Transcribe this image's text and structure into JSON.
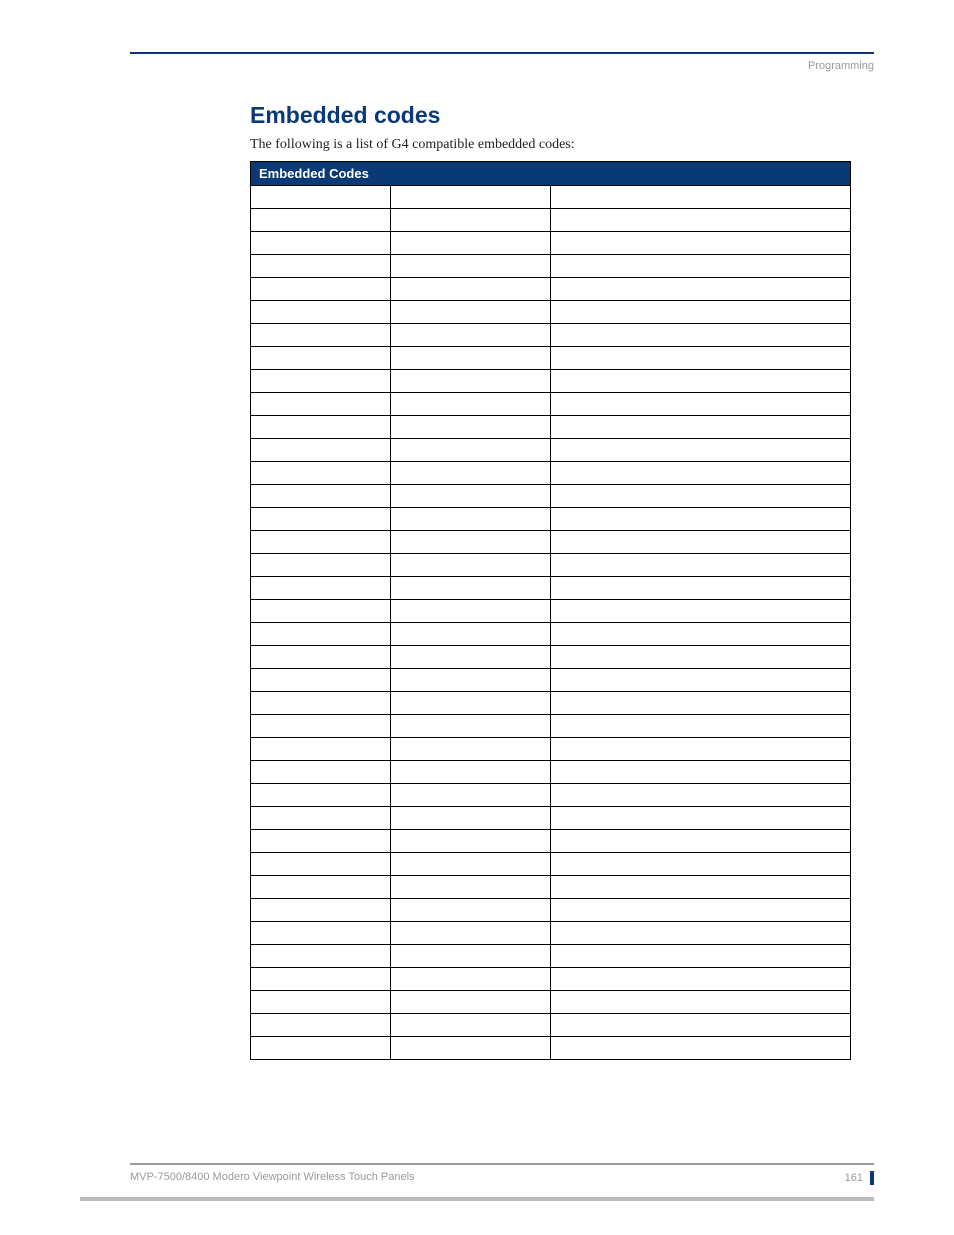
{
  "header": {
    "section_label": "Programming"
  },
  "section": {
    "title": "Embedded codes",
    "intro": "The following is a list of G4 compatible embedded codes:",
    "table_title": "Embedded Codes",
    "row_count": 38
  },
  "footer": {
    "doc_title": "MVP-7500/8400 Modero Viewpoint Wireless Touch Panels",
    "page_number": "161"
  }
}
